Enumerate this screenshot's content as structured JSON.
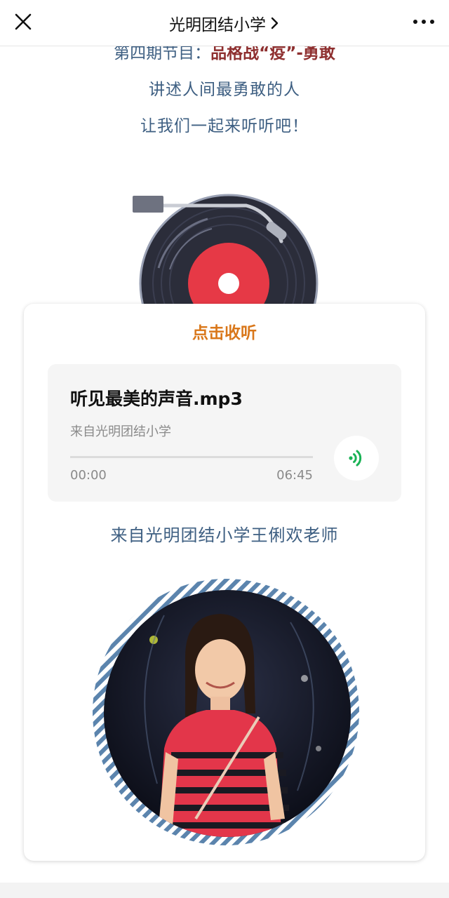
{
  "nav": {
    "title": "光明团结小学",
    "chevron": ">"
  },
  "intro": {
    "line1_prefix": "第四期节目：",
    "line1_highlight": "品格战“疫”-勇敢",
    "line2": "讲述人间最勇敢的人",
    "line3": "让我们一起来听听吧！"
  },
  "card": {
    "title": "点击收听",
    "audio": {
      "title": "听见最美的声音.mp3",
      "source": "来自光明团结小学",
      "current_time": "00:00",
      "total_time": "06:45",
      "progress": 0
    },
    "teacher_caption": "来自光明团结小学王俐欢老师"
  },
  "icons": {
    "close": "close-icon",
    "more": "more-icon",
    "play": "audio-wave-icon",
    "record": "vinyl-record-illustration"
  },
  "colors": {
    "accent_orange": "#d9771a",
    "text_blue": "#3e5f82",
    "highlight_red": "#8e2f2f",
    "wave_green": "#19b255",
    "record_red": "#e63946"
  }
}
